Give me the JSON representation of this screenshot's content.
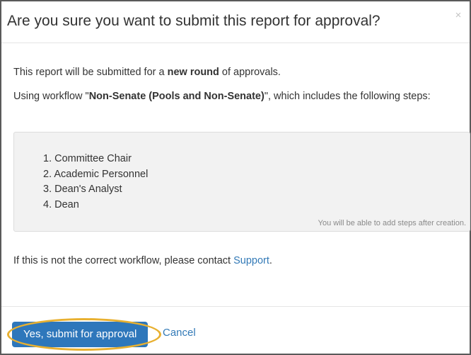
{
  "dialog": {
    "title": "Are you sure you want to submit this report for approval?",
    "close_glyph": "×"
  },
  "body": {
    "p1": {
      "prefix": "This report will be submitted for a ",
      "bold": "new round",
      "suffix": " of approvals."
    },
    "p2": {
      "prefix": "Using workflow \"",
      "bold": "Non-Senate (Pools and Non-Senate)",
      "suffix": "\", which includes the following steps:"
    },
    "steps": [
      "1. Committee Chair",
      "2. Academic Personnel",
      "3. Dean's Analyst",
      "4. Dean"
    ],
    "steps_note": "You will be able to add steps after creation.",
    "p3": {
      "prefix": "If this is not the correct workflow, please contact ",
      "link": "Support",
      "suffix": "."
    }
  },
  "footer": {
    "submit_label": "Yes, submit for approval",
    "cancel_label": "Cancel"
  },
  "colors": {
    "primary": "#2e77bb",
    "link": "#337ab7",
    "highlight": "#e8b030"
  },
  "icons": {
    "close": "close-icon"
  }
}
